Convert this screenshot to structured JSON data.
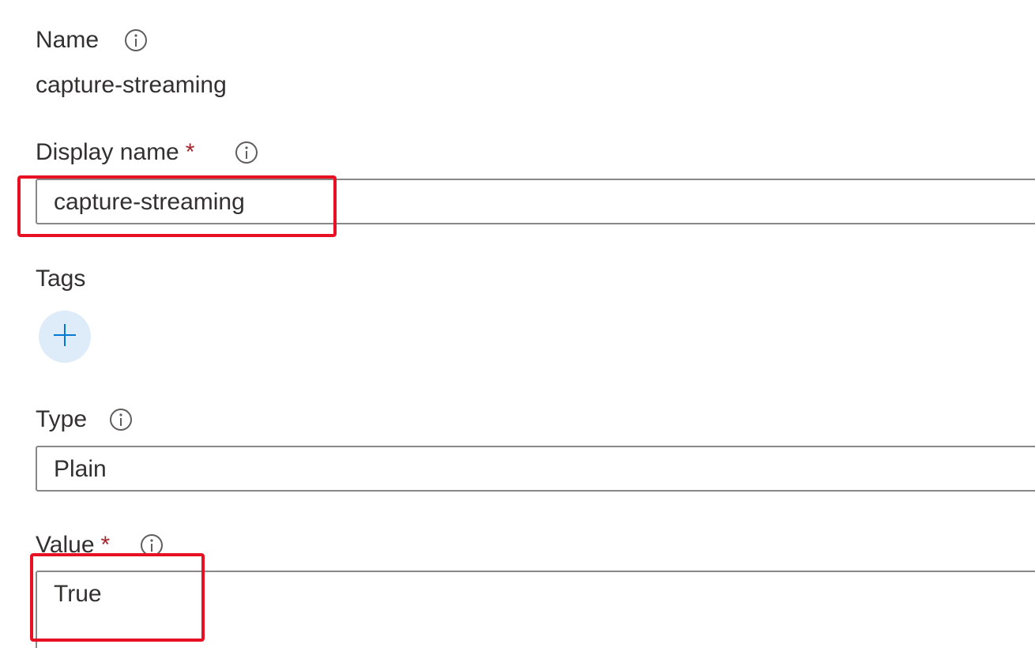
{
  "form": {
    "name": {
      "label": "Name",
      "value": "capture-streaming"
    },
    "display_name": {
      "label": "Display name",
      "required_marker": "*",
      "value": "capture-streaming"
    },
    "tags": {
      "label": "Tags"
    },
    "type": {
      "label": "Type",
      "value": "Plain"
    },
    "value": {
      "label": "Value",
      "required_marker": "*",
      "value": "True"
    }
  },
  "colors": {
    "accent": "#0078d4",
    "required": "#a4262c",
    "highlight": "#e81123",
    "add_button_bg": "#deecf9"
  },
  "icons": {
    "info": "info-icon",
    "add": "plus-icon"
  }
}
